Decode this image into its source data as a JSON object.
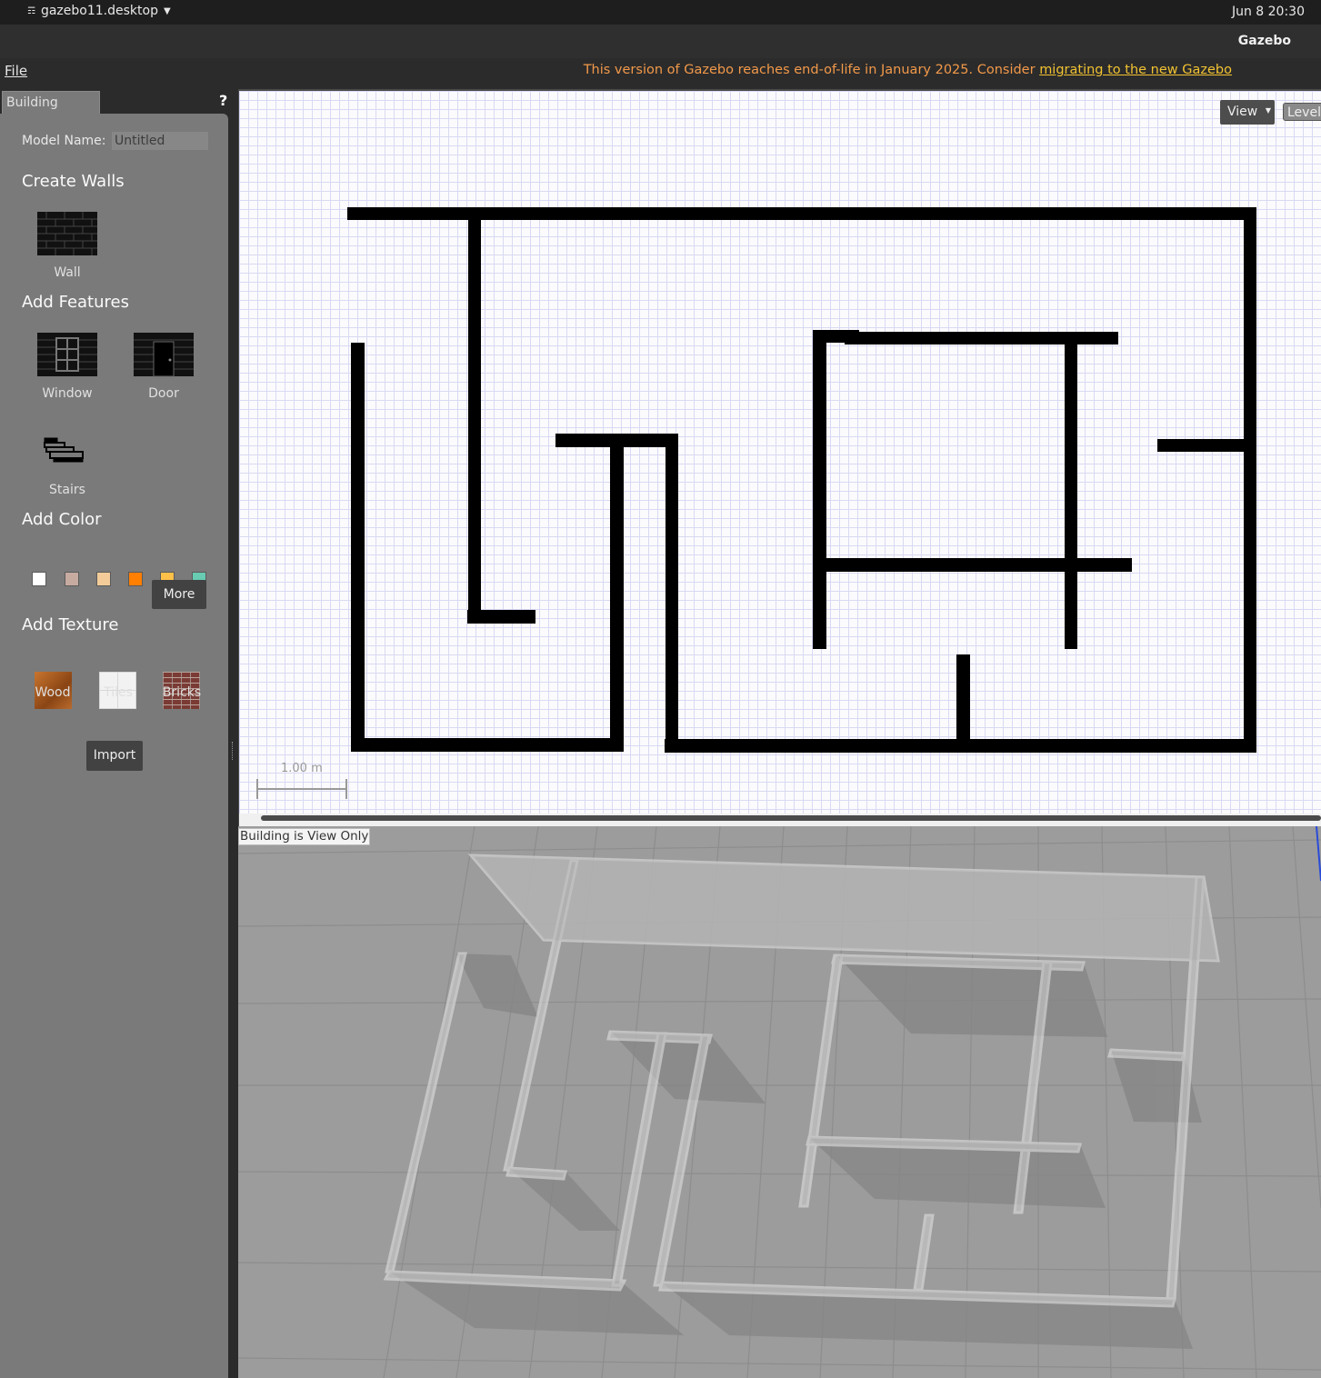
{
  "system_bar": {
    "app_name": "gazebo11.desktop",
    "clock": "Jun 8  20:30"
  },
  "window": {
    "title": "Gazebo"
  },
  "menu": {
    "file_label": "File",
    "notice_text": "This version of Gazebo reaches end-of-life in January 2025. Consider ",
    "notice_link": "migrating to the new Gazebo"
  },
  "panel": {
    "tab_label": "Building Editor",
    "help_label": "?",
    "model_name_label": "Model Name:",
    "model_name_value": "Untitled",
    "create_walls_header": "Create Walls",
    "wall_label": "Wall",
    "add_features_header": "Add Features",
    "window_label": "Window",
    "door_label": "Door",
    "stairs_label": "Stairs",
    "add_color_header": "Add Color",
    "colors": [
      "#ffffff",
      "#c7aba1",
      "#f3cc9a",
      "#ff7f00",
      "#ffc04a",
      "#68cbb2"
    ],
    "more_label": "More",
    "add_texture_header": "Add Texture",
    "textures": [
      "Wood",
      "Tiles",
      "Bricks"
    ],
    "import_label": "Import"
  },
  "editor": {
    "view_label": "View",
    "level_label": "Level",
    "scale_label": "1.00 m"
  },
  "view3d": {
    "status_label": "Building is View Only"
  }
}
